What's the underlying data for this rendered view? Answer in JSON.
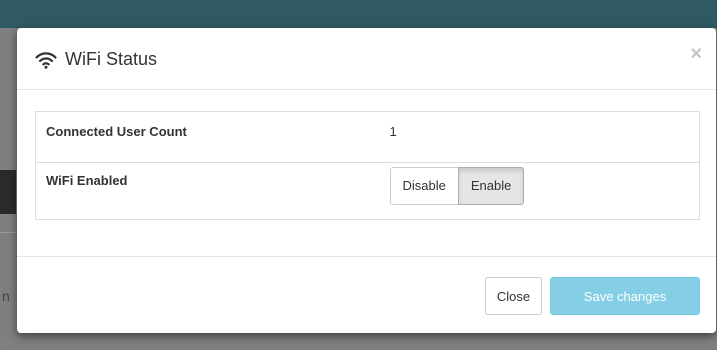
{
  "modal": {
    "title": "WiFi Status",
    "close_symbol": "×",
    "title_icon": "wifi-icon"
  },
  "table": {
    "rows": [
      {
        "label": "Connected User Count",
        "value": "1"
      },
      {
        "label": "WiFi Enabled",
        "options": [
          "Disable",
          "Enable"
        ],
        "selected": "Enable"
      }
    ]
  },
  "footer": {
    "close_label": "Close",
    "save_label": "Save changes"
  },
  "colors": {
    "primary_button": "#5bc0de",
    "header_bar": "#2f5a63"
  }
}
